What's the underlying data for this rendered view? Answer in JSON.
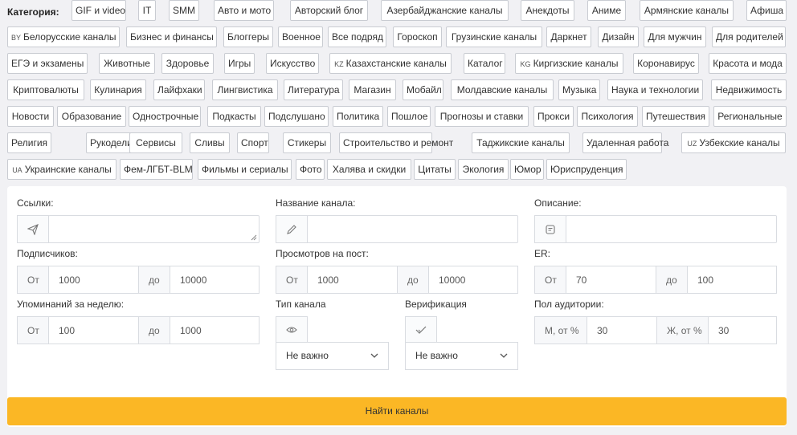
{
  "category_label": "Категория:",
  "categories": [
    {
      "label": "GIF и video"
    },
    {
      "label": "IT"
    },
    {
      "label": "SMM"
    },
    {
      "label": "Авто и мото"
    },
    {
      "label": "Авторский блог"
    },
    {
      "label": "Азербайджанские каналы"
    },
    {
      "label": "Анекдоты"
    },
    {
      "label": "Аниме"
    },
    {
      "label": "Армянские каналы"
    },
    {
      "label": "Афиша"
    },
    {
      "code": "BY",
      "label": "Белорусские каналы"
    },
    {
      "label": "Бизнес и финансы"
    },
    {
      "label": "Блоггеры"
    },
    {
      "label": "Военное"
    },
    {
      "label": "Все подряд"
    },
    {
      "label": "Гороскоп"
    },
    {
      "label": "Грузинские каналы"
    },
    {
      "label": "Даркнет"
    },
    {
      "label": "Дизайн"
    },
    {
      "label": "Для мужчин"
    },
    {
      "label": "Для родителей"
    },
    {
      "label": "ЕГЭ и экзамены"
    },
    {
      "label": "Животные"
    },
    {
      "label": "Здоровье"
    },
    {
      "label": "Игры"
    },
    {
      "label": "Искусство"
    },
    {
      "code": "KZ",
      "label": "Казахстанские каналы"
    },
    {
      "label": "Каталог"
    },
    {
      "code": "KG",
      "label": "Киргизские каналы"
    },
    {
      "label": "Коронавирус"
    },
    {
      "label": "Красота и мода"
    },
    {
      "label": "Криптовалюты"
    },
    {
      "label": "Кулинария"
    },
    {
      "label": "Лайфхаки"
    },
    {
      "label": "Лингвистика"
    },
    {
      "label": "Литература"
    },
    {
      "label": "Магазин"
    },
    {
      "label": "Мобайл"
    },
    {
      "label": "Молдавские каналы"
    },
    {
      "label": "Музыка"
    },
    {
      "label": "Наука и технологии"
    },
    {
      "label": "Недвижимость"
    },
    {
      "label": "Новости"
    },
    {
      "label": "Образование"
    },
    {
      "label": "Однострочные"
    },
    {
      "label": "Подкасты"
    },
    {
      "label": "Подслушано"
    },
    {
      "label": "Политика"
    },
    {
      "label": "Пошлое"
    },
    {
      "label": "Прогнозы и ставки"
    },
    {
      "label": "Прокси"
    },
    {
      "label": "Психология"
    },
    {
      "label": "Путешествия"
    },
    {
      "label": "Региональные"
    },
    {
      "label": "Религия"
    },
    {
      "label": "Рукоделие"
    },
    {
      "label": "Сервисы"
    },
    {
      "label": "Сливы"
    },
    {
      "label": "Спорт"
    },
    {
      "label": "Стикеры"
    },
    {
      "label": "Строительство и ремонт"
    },
    {
      "label": "Таджикские каналы"
    },
    {
      "label": "Удаленная работа"
    },
    {
      "code": "UZ",
      "label": "Узбекские каналы"
    },
    {
      "code": "UA",
      "label": "Украинские каналы"
    },
    {
      "label": "Фем-ЛГБТ-BLM"
    },
    {
      "label": "Фильмы и сериалы"
    },
    {
      "label": "Фото"
    },
    {
      "label": "Халява и скидки"
    },
    {
      "label": "Цитаты"
    },
    {
      "label": "Экология"
    },
    {
      "label": "Юмор"
    },
    {
      "label": "Юриспруденция"
    }
  ],
  "filters": {
    "links": {
      "label": "Ссылки:",
      "icon": "send-icon",
      "value": ""
    },
    "channel_name": {
      "label": "Название канала:",
      "icon": "pencil-icon",
      "value": ""
    },
    "description": {
      "label": "Описание:",
      "icon": "note-icon",
      "value": ""
    },
    "subscribers": {
      "label": "Подписчиков:",
      "from_prefix": "От",
      "from_value": "1000",
      "to_prefix": "до",
      "to_value": "10000"
    },
    "views": {
      "label": "Просмотров на пост:",
      "from_prefix": "От",
      "from_value": "1000",
      "to_prefix": "до",
      "to_value": "10000"
    },
    "er": {
      "label": "ER:",
      "from_prefix": "От",
      "from_value": "70",
      "to_prefix": "до",
      "to_value": "100"
    },
    "mentions": {
      "label": "Упоминаний за неделю:",
      "from_prefix": "От",
      "from_value": "100",
      "to_prefix": "до",
      "to_value": "1000"
    },
    "channel_type": {
      "label": "Тип канала",
      "icon": "eye-icon",
      "selected": "Не важно"
    },
    "verification": {
      "label": "Верификация",
      "icon": "check-icon",
      "selected": "Не важно"
    },
    "audience": {
      "label": "Пол аудитории:",
      "male_prefix": "М, от %",
      "male_value": "30",
      "female_prefix": "Ж, от %",
      "female_value": "30"
    }
  },
  "search_button": "Найти каналы",
  "colors": {
    "accent": "#fbb725",
    "border": "#d9dce1",
    "background": "#f1f1f4"
  }
}
